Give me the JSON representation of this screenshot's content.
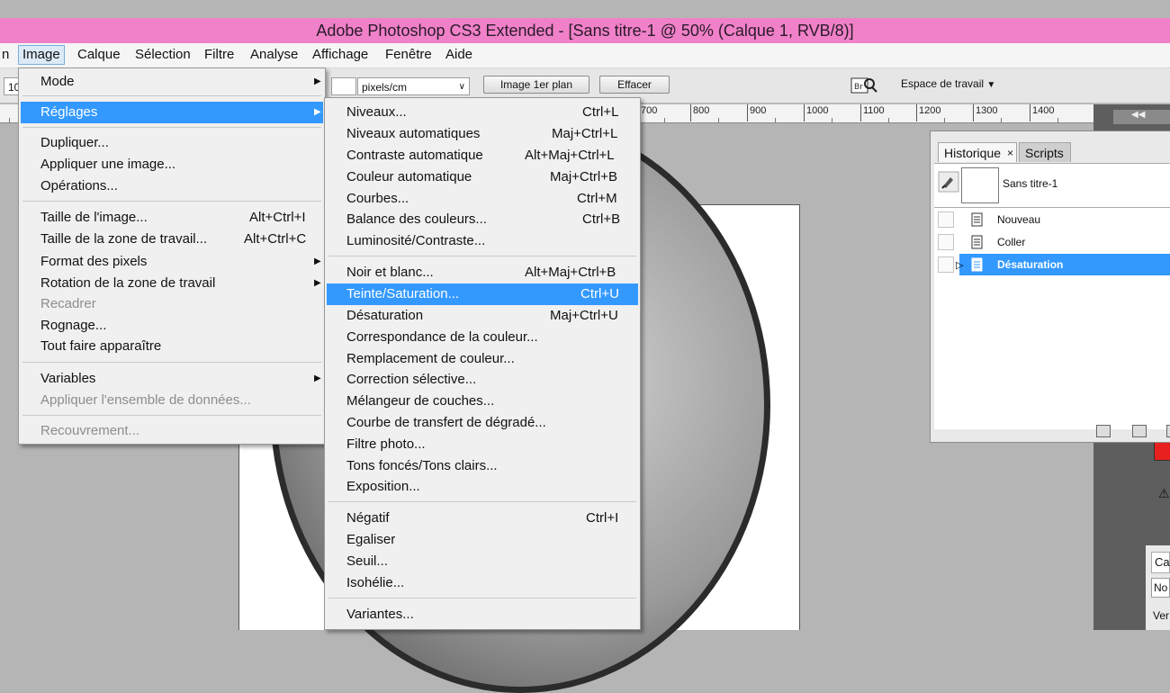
{
  "window": {
    "title": "Adobe Photoshop CS3 Extended - [Sans titre-1 @ 50% (Calque 1, RVB/8)]"
  },
  "menubar": {
    "items": [
      {
        "label": "n"
      },
      {
        "label": "Image"
      },
      {
        "label": "Calque"
      },
      {
        "label": "Sélection"
      },
      {
        "label": "Filtre"
      },
      {
        "label": "Analyse"
      },
      {
        "label": "Affichage"
      },
      {
        "label": "Fenêtre"
      },
      {
        "label": "Aide"
      }
    ]
  },
  "options_bar": {
    "left_field": "10",
    "unit_select": "pixels/cm",
    "front_image_button": "Image 1er plan",
    "clear_button": "Effacer",
    "workspace_label": "Espace de travail",
    "bridge_icon": "bridge-icon"
  },
  "ruler": {
    "labels": [
      "700",
      "800",
      "900",
      "1000",
      "1100",
      "1200",
      "1300",
      "1400"
    ]
  },
  "image_menu": {
    "items": [
      {
        "label": "Mode"
      },
      {
        "label": "Réglages"
      },
      {
        "label": "Dupliquer..."
      },
      {
        "label": "Appliquer une image..."
      },
      {
        "label": "Opérations..."
      },
      {
        "label": "Taille de l'image...",
        "shortcut": "Alt+Ctrl+I"
      },
      {
        "label": "Taille de la zone de travail...",
        "shortcut": "Alt+Ctrl+C"
      },
      {
        "label": "Format des pixels"
      },
      {
        "label": "Rotation de la zone de travail"
      },
      {
        "label": "Recadrer"
      },
      {
        "label": "Rognage..."
      },
      {
        "label": "Tout faire apparaître"
      },
      {
        "label": "Variables"
      },
      {
        "label": "Appliquer l'ensemble de données..."
      },
      {
        "label": "Recouvrement..."
      }
    ]
  },
  "adjustments_menu": {
    "items": [
      {
        "label": "Niveaux...",
        "shortcut": "Ctrl+L"
      },
      {
        "label": "Niveaux automatiques",
        "shortcut": "Maj+Ctrl+L"
      },
      {
        "label": "Contraste automatique",
        "shortcut": "Alt+Maj+Ctrl+L"
      },
      {
        "label": "Couleur automatique",
        "shortcut": "Maj+Ctrl+B"
      },
      {
        "label": "Courbes...",
        "shortcut": "Ctrl+M"
      },
      {
        "label": "Balance des couleurs...",
        "shortcut": "Ctrl+B"
      },
      {
        "label": "Luminosité/Contraste..."
      },
      {
        "label": "Noir et blanc...",
        "shortcut": "Alt+Maj+Ctrl+B"
      },
      {
        "label": "Teinte/Saturation...",
        "shortcut": "Ctrl+U"
      },
      {
        "label": "Désaturation",
        "shortcut": "Maj+Ctrl+U"
      },
      {
        "label": "Correspondance de la couleur..."
      },
      {
        "label": "Remplacement de couleur..."
      },
      {
        "label": "Correction sélective..."
      },
      {
        "label": "Mélangeur de couches..."
      },
      {
        "label": "Courbe de transfert de dégradé..."
      },
      {
        "label": "Filtre photo..."
      },
      {
        "label": "Tons foncés/Tons clairs..."
      },
      {
        "label": "Exposition..."
      },
      {
        "label": "Négatif",
        "shortcut": "Ctrl+I"
      },
      {
        "label": "Egaliser"
      },
      {
        "label": "Seuil..."
      },
      {
        "label": "Isohélie..."
      },
      {
        "label": "Variantes..."
      }
    ]
  },
  "history_panel": {
    "tabs": [
      {
        "label": "Historique"
      },
      {
        "label": "Scripts"
      }
    ],
    "snapshot_label": "Sans titre-1",
    "states": [
      {
        "label": "Nouveau"
      },
      {
        "label": "Coller"
      },
      {
        "label": "Désaturation"
      }
    ]
  },
  "dock": {
    "tab_fragment": "Ca",
    "field_fragment": "No",
    "label_fragment": "Ver"
  },
  "colors": {
    "title_bar": "#f081c8",
    "highlight": "#3399ff",
    "swatch": "#e8201e"
  }
}
